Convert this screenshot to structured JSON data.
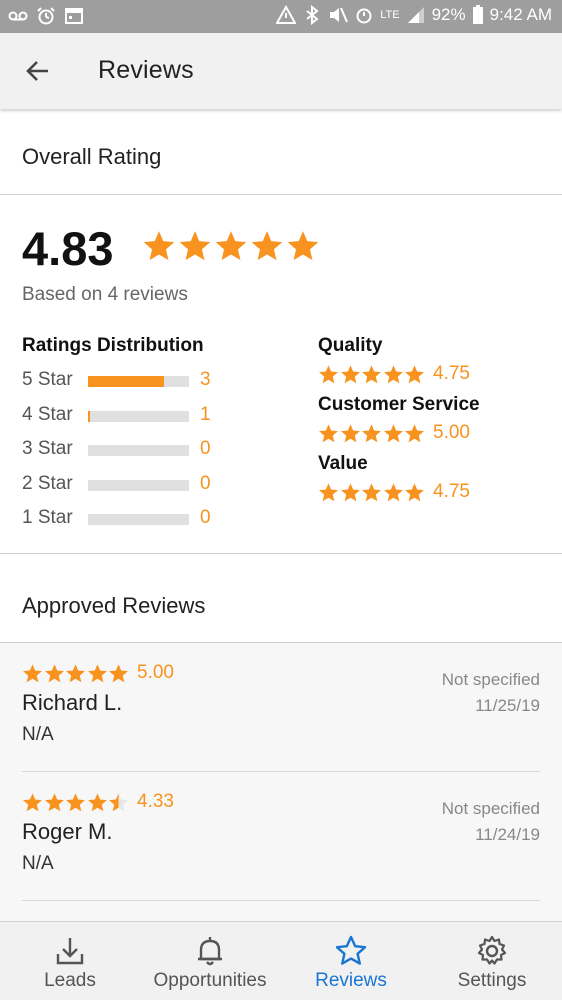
{
  "status_bar": {
    "lte": "LTE",
    "battery": "92%",
    "time": "9:42 AM"
  },
  "app_bar": {
    "title": "Reviews"
  },
  "overall": {
    "section_title": "Overall Rating",
    "score": "4.83",
    "score_value": 4.83,
    "based_on": "Based on 4 reviews"
  },
  "distribution": {
    "title": "Ratings Distribution",
    "rows": [
      {
        "label": "5 Star",
        "count": "3",
        "fraction": 0.75
      },
      {
        "label": "4 Star",
        "count": "1",
        "fraction": 0.02
      },
      {
        "label": "3 Star",
        "count": "0",
        "fraction": 0
      },
      {
        "label": "2 Star",
        "count": "0",
        "fraction": 0
      },
      {
        "label": "1 Star",
        "count": "0",
        "fraction": 0
      }
    ]
  },
  "categories": [
    {
      "title": "Quality",
      "value": "4.75",
      "stars": 5
    },
    {
      "title": "Customer Service",
      "value": "5.00",
      "stars": 5
    },
    {
      "title": "Value",
      "value": "4.75",
      "stars": 5
    }
  ],
  "approved": {
    "section_title": "Approved Reviews",
    "reviews": [
      {
        "score": "5.00",
        "stars": 5,
        "name": "Richard L.",
        "detail": "N/A",
        "status": "Not specified",
        "date": "11/25/19"
      },
      {
        "score": "4.33",
        "stars": 4.5,
        "name": "Roger M.",
        "detail": "N/A",
        "status": "Not specified",
        "date": "11/24/19"
      }
    ]
  },
  "bottom_nav": {
    "items": [
      {
        "label": "Leads",
        "icon": "download-icon"
      },
      {
        "label": "Opportunities",
        "icon": "bell-icon"
      },
      {
        "label": "Reviews",
        "icon": "star-icon",
        "active": true
      },
      {
        "label": "Settings",
        "icon": "gear-icon"
      }
    ]
  },
  "colors": {
    "accent": "#f7931e",
    "active_nav": "#1976d2",
    "status_bar": "#9e9e9e"
  }
}
